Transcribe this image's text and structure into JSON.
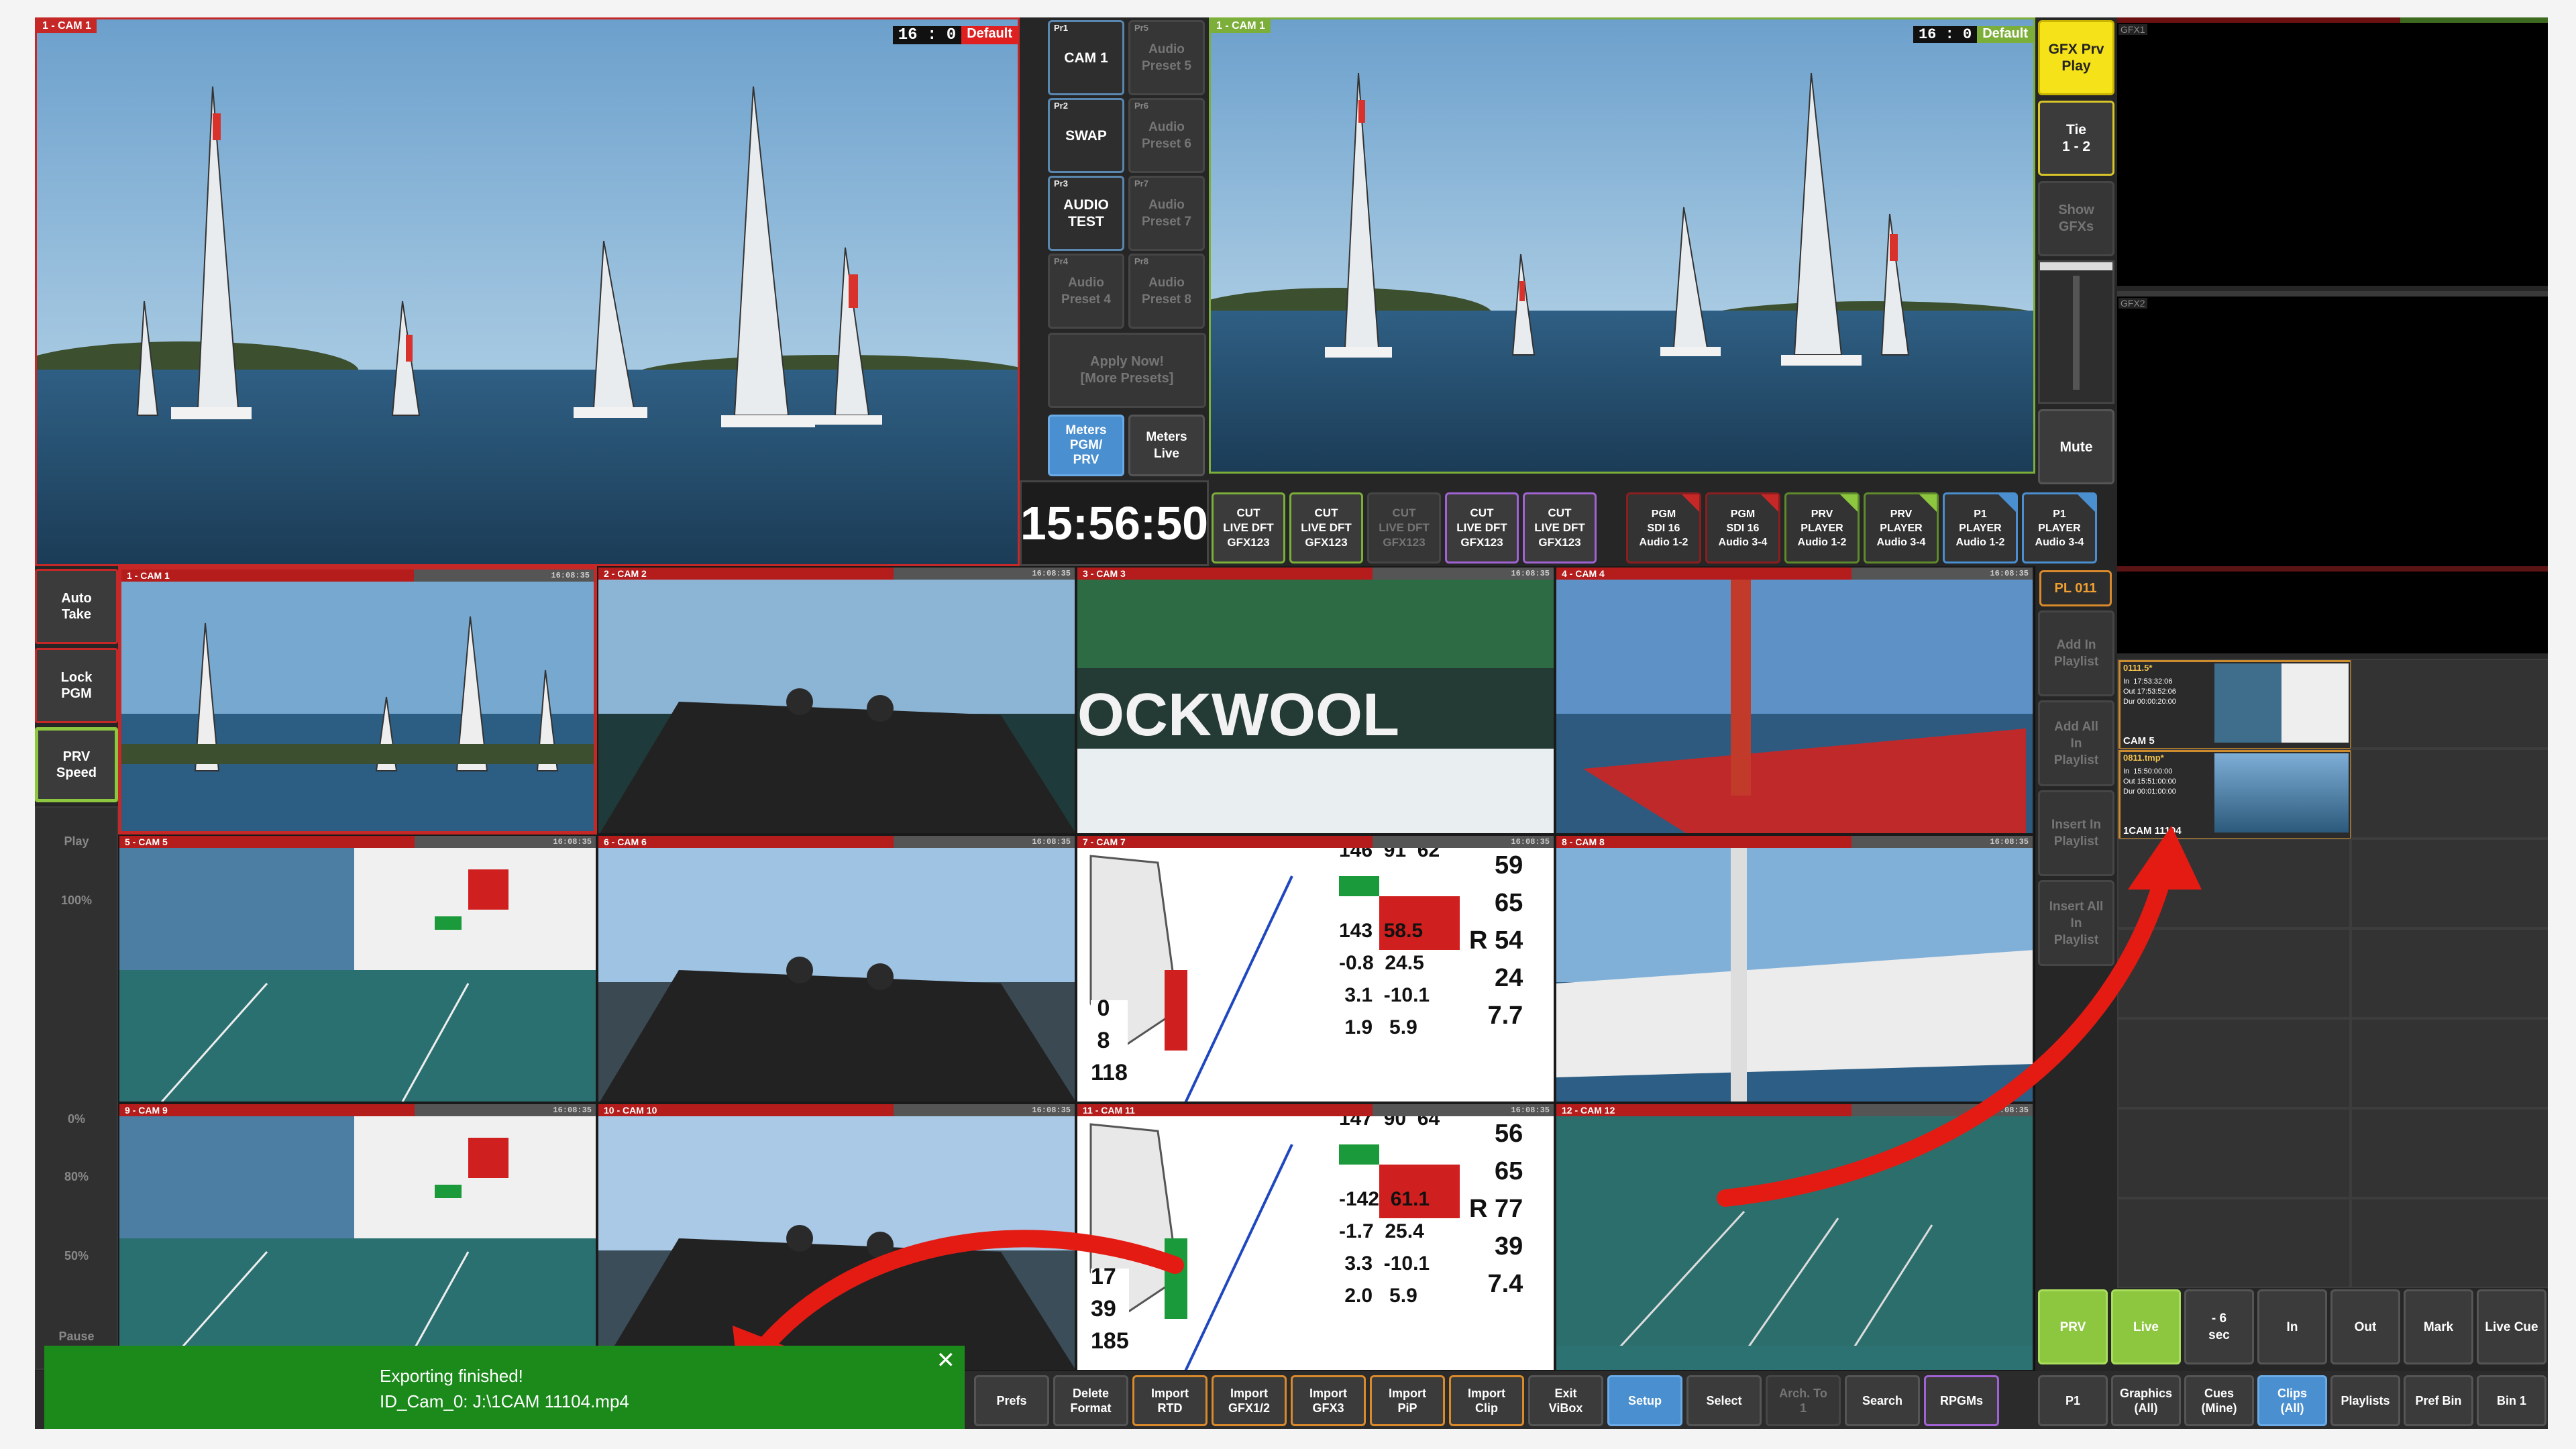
{
  "colors": {
    "accent_red": "#c62828",
    "accent_green": "#8dc63f",
    "accent_yellow": "#f5e219",
    "accent_blue": "#4a8fcf",
    "accent_orange": "#d98a2b",
    "accent_purple": "#a163d3",
    "toast_green": "#1b8a1b",
    "arrow_red": "#e41b13"
  },
  "preview_monitor": {
    "label": "1 - CAM 1",
    "timecode": "16 : 0",
    "badge": "Default"
  },
  "program_monitor": {
    "label": "1 - CAM 1",
    "timecode": "16 : 0",
    "badge": "Default"
  },
  "presets": [
    {
      "tag": "Pr1",
      "label": "CAM 1",
      "active": true
    },
    {
      "tag": "Pr5",
      "label": "Audio\nPreset 5",
      "active": false
    },
    {
      "tag": "Pr2",
      "label": "SWAP",
      "active": true
    },
    {
      "tag": "Pr6",
      "label": "Audio\nPreset 6",
      "active": false
    },
    {
      "tag": "Pr3",
      "label": "AUDIO\nTEST",
      "active": true
    },
    {
      "tag": "Pr7",
      "label": "Audio\nPreset 7",
      "active": false
    },
    {
      "tag": "Pr4",
      "label": "Audio\nPreset 4",
      "active": false
    },
    {
      "tag": "Pr8",
      "label": "Audio\nPreset 8",
      "active": false
    }
  ],
  "apply_presets": "Apply Now!\n[More Presets]",
  "meters": {
    "pgm_prv": "Meters\nPGM/\nPRV",
    "live": "Meters\nLive"
  },
  "clock": "15:56:50",
  "cut_buttons": [
    {
      "label": "CUT\nLIVE DFT\nGFX123",
      "color": "green",
      "dim": false
    },
    {
      "label": "CUT\nLIVE DFT\nGFX123",
      "color": "green",
      "dim": false
    },
    {
      "label": "CUT\nLIVE DFT\nGFX123",
      "color": "",
      "dim": true
    },
    {
      "label": "CUT\nLIVE DFT\nGFX123",
      "color": "purple",
      "dim": false
    },
    {
      "label": "CUT\nLIVE DFT\nGFX123",
      "color": "purple",
      "dim": false
    }
  ],
  "output_buttons": [
    {
      "label": "PGM\nSDI 16\nAudio 1-2",
      "color": "red"
    },
    {
      "label": "PGM\nSDI 16\nAudio 3-4",
      "color": "red"
    },
    {
      "label": "PRV\nPLAYER\nAudio 1-2",
      "color": "green"
    },
    {
      "label": "PRV\nPLAYER\nAudio 3-4",
      "color": "green"
    },
    {
      "label": "P1\nPLAYER\nAudio 1-2",
      "color": "blue"
    },
    {
      "label": "P1\nPLAYER\nAudio 3-4",
      "color": "blue"
    }
  ],
  "gfx_controls": {
    "gfx_prv_play": "GFX Prv\nPlay",
    "tie": "Tie\n1 - 2",
    "show_gfxs": "Show\nGFXs",
    "mute": "Mute"
  },
  "gfx_previews": {
    "gfx1": "GFX1",
    "gfx2": "GFX2"
  },
  "left_controls": {
    "auto_take": "Auto\nTake",
    "lock_pgm": "Lock\nPGM",
    "prv_speed": "PRV\nSpeed",
    "play": "Play",
    "speed_100": "100%",
    "speed_0": "0%",
    "speed_80": "80%",
    "speed_50": "50%",
    "pause": "Pause"
  },
  "multiview": [
    {
      "label": "1 - CAM 1",
      "tc": "16:08:35"
    },
    {
      "label": "2 - CAM 2",
      "tc": "16:08:35"
    },
    {
      "label": "3 - CAM 3",
      "tc": "16:08:35"
    },
    {
      "label": "4 - CAM 4",
      "tc": "16:08:35"
    },
    {
      "label": "5 - CAM 5",
      "tc": "16:08:35"
    },
    {
      "label": "6 - CAM 6",
      "tc": "16:08:35"
    },
    {
      "label": "7 - CAM 7",
      "tc": "16:08:35"
    },
    {
      "label": "8 - CAM 8",
      "tc": "16:08:35"
    },
    {
      "label": "9 - CAM 9",
      "tc": "16:08:35"
    },
    {
      "label": "10 - CAM 10",
      "tc": "16:08:35"
    },
    {
      "label": "11 - CAM 11",
      "tc": "16:08:35"
    },
    {
      "label": "12 - CAM 12",
      "tc": "16:08:35"
    }
  ],
  "cam7_overlay": "146  91  62\n\n\n\n\n143  58.5\n\n-0.8  24.5\n\n 3.1  -10.1\n\n 1.9   5.9",
  "cam7_right": "59\n\n65\n\nR 54\n\n24\n\n7.7\n\n",
  "cam7_left": " 0\n\n 8\n\n118",
  "cam11_overlay": "147  90  64\n\n\n\n\n-142  61.1\n\n-1.7  25.4\n\n 3.3  -10.1\n\n 2.0   5.9",
  "cam11_right": "56\n\n65\n\nR 77\n\n39\n\n7.4\n\n",
  "cam11_left": "17\n\n39\n\n185",
  "playlist": {
    "header": "PL 011",
    "add_in": "Add In\nPlaylist",
    "add_all_in": "Add All\nIn\nPlaylist",
    "insert_in": "Insert In\nPlaylist",
    "insert_all_in": "Insert All\nIn\nPlaylist"
  },
  "clips": [
    {
      "title": "0111.5*",
      "info": "In  17:53:32:06\nOut 17:53:52:06\nDur 00:00:20:00",
      "name": "CAM 5"
    },
    {
      "title": "0811.tmp*",
      "info": "In  15:50:00:00\nOut 15:51:00:00\nDur 00:01:00:00",
      "name": "1CAM 11104"
    }
  ],
  "clip_controls": [
    "PRV",
    "Live",
    "- 6\nsec",
    "In",
    "Out",
    "Mark",
    "Live Cue"
  ],
  "bottom_bar": [
    "Prefs",
    "Delete\nFormat",
    "Import\nRTD",
    "Import\nGFX1/2",
    "Import\nGFX3",
    "Import\nPiP",
    "Import\nClip",
    "Exit\nViBox",
    "Setup",
    "Select",
    "Arch. To\n1",
    "Search",
    "RPGMs",
    "P1",
    "Graphics\n(All)",
    "Cues\n(Mine)",
    "Clips\n(All)",
    "Playlists",
    "Pref Bin",
    "Bin 1"
  ],
  "toast": {
    "title": "Exporting finished!",
    "detail": "ID_Cam_0: J:\\1CAM 11104.mp4",
    "close": "✕"
  }
}
